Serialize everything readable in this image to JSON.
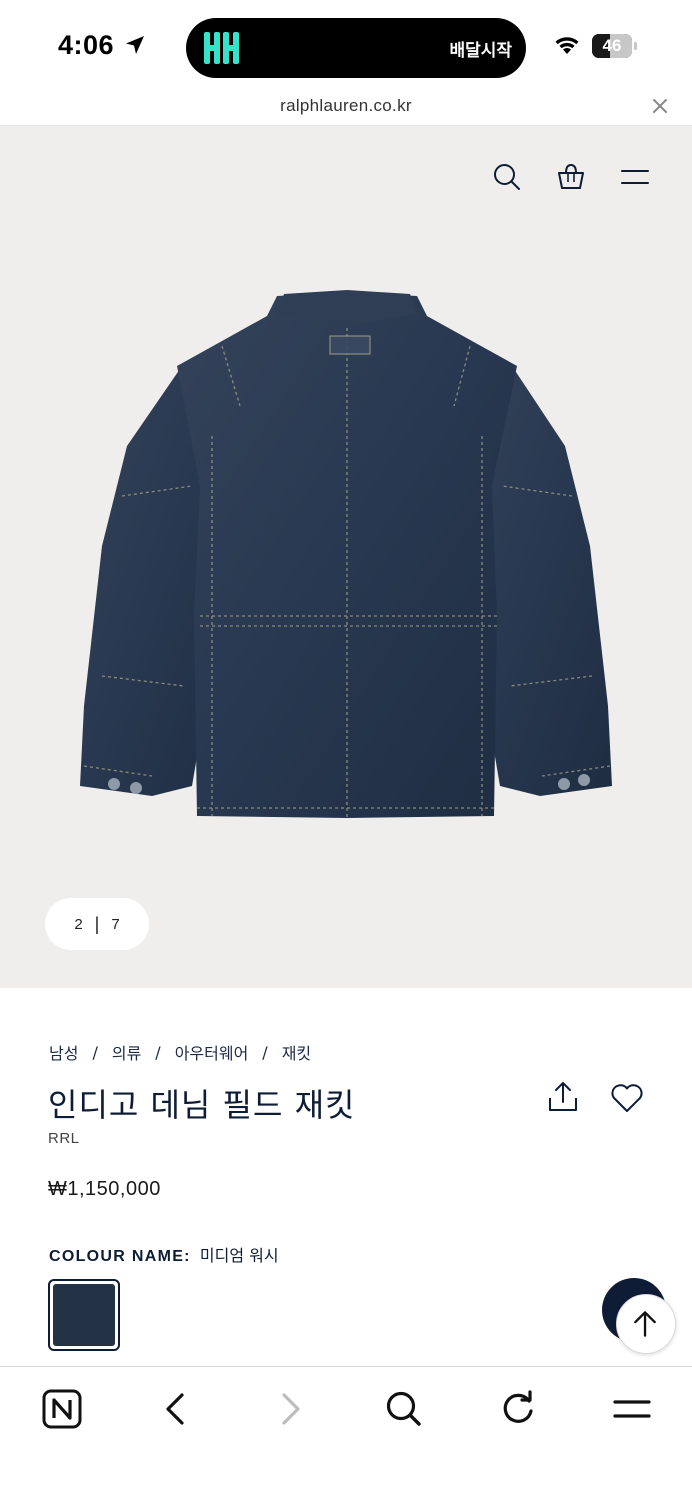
{
  "status_bar": {
    "time": "4:06",
    "island_text": "배달시작",
    "battery_level": "46",
    "battery_fraction": 0.46
  },
  "browser": {
    "url": "ralphlauren.co.kr"
  },
  "gallery": {
    "current_index": "2",
    "separator": "|",
    "total": "7"
  },
  "product": {
    "breadcrumb": [
      "남성",
      "의류",
      "아우터웨어",
      "재킷"
    ],
    "breadcrumb_separator": "/",
    "title": "인디고 데님 필드 재킷",
    "brand": "RRL",
    "price": "₩1,150,000",
    "colour_label": "COLOUR NAME:",
    "colour_value": "미디엄 워시",
    "swatch_color": "#243246"
  },
  "icons": {
    "header": [
      "search-icon",
      "shopping-bag-icon",
      "menu-icon"
    ],
    "product_actions": [
      "share-icon",
      "heart-icon"
    ],
    "toolbar": [
      "naver-home-icon",
      "back-arrow-icon",
      "forward-arrow-icon",
      "search-icon",
      "reload-icon",
      "menu-icon"
    ]
  },
  "colors": {
    "accent_navy": "#0f1c36",
    "hero_background": "#efeeec",
    "island_logo": "#34e3c8"
  }
}
